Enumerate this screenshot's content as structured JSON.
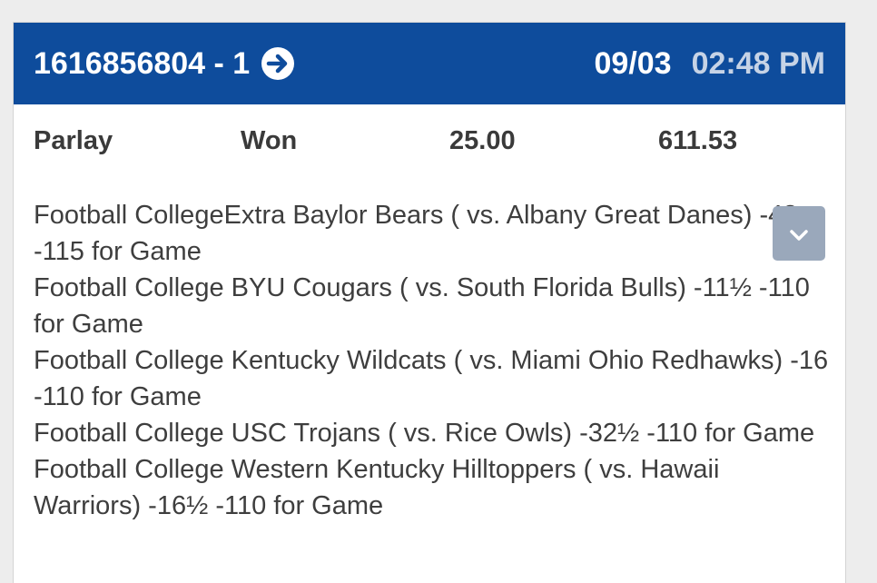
{
  "ticket": {
    "id": "1616856804 - 1",
    "date": "09/03",
    "time": "02:48 PM"
  },
  "summary": {
    "type": "Parlay",
    "status": "Won",
    "risk": "25.00",
    "win": "611.53"
  },
  "legs": [
    "Football CollegeExtra Baylor Bears ( vs. Albany Great Danes) -42 -115 for Game",
    "Football College BYU Cougars ( vs. South Florida Bulls) -11½ -110 for Game",
    "Football College Kentucky Wildcats ( vs. Miami Ohio Redhawks) -16 -110 for Game",
    "Football College USC Trojans ( vs. Rice Owls) -32½ -110 for Game",
    "Football College Western Kentucky Hilltoppers ( vs. Hawaii Warriors) -16½ -110 for Game"
  ],
  "icons": {
    "header_arrow": "arrow-right-circle-icon",
    "toggle": "chevron-down-icon"
  },
  "colors": {
    "header_bg": "#0e4c9c",
    "time_text": "#c6d3e6",
    "toggle_bg": "#9aa8bb"
  }
}
